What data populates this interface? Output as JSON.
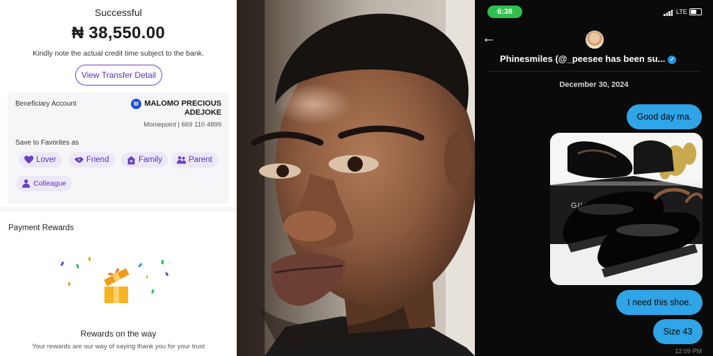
{
  "receipt": {
    "status": "Successful",
    "amount": "₦ 38,550.00",
    "note": "Kindly note the actual credit time subject to the bank.",
    "view_detail_button": "View Transfer Detail",
    "beneficiary_label": "Beneficiary Account",
    "bank_logo_letter": "M",
    "beneficiary_name": "MALOMO PRECIOUS ADEJOKE",
    "beneficiary_account": "Moniepoint | 669 110 4899",
    "save_favorites_label": "Save to Favorites as",
    "favorites": [
      {
        "label": "Lover",
        "icon": "heart-icon"
      },
      {
        "label": "Friend",
        "icon": "handshake-icon"
      },
      {
        "label": "Family",
        "icon": "home-icon"
      },
      {
        "label": "Parent",
        "icon": "people-icon"
      },
      {
        "label": "Colleague",
        "icon": "person-icon"
      }
    ],
    "rewards_title": "Payment Rewards",
    "rewards_subtitle": "Rewards on the way",
    "rewards_description": "Your rewards are our way of saying thank you for your trust",
    "accent_color": "#5b2fbf"
  },
  "chat": {
    "status_time": "6:38",
    "network": "LTE",
    "title": "Phinesmiles (@_peesee has been su...",
    "date": "December 30, 2024",
    "messages": [
      {
        "text": "Good day ma."
      },
      {
        "text": "I need this shoe."
      },
      {
        "text": "Size 43"
      }
    ],
    "shoe_box_brand": "GIVENCHY",
    "last_message_time": "12:09 PM",
    "bubble_color": "#2fa4e7"
  }
}
